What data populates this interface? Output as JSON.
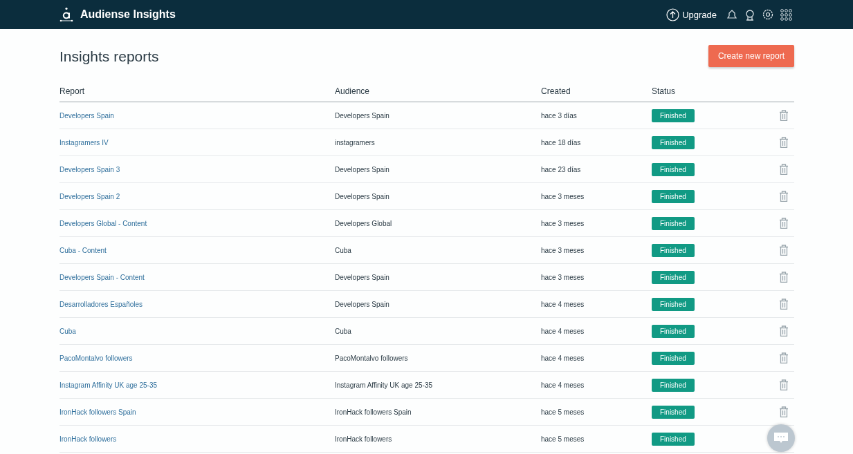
{
  "app": {
    "name": "Audiense Insights",
    "upgrade": "Upgrade"
  },
  "page": {
    "title": "Insights reports",
    "create_button": "Create new report"
  },
  "table": {
    "columns": [
      "Report",
      "Audience",
      "Created",
      "Status"
    ],
    "rows": [
      {
        "report": "Developers Spain",
        "audience": "Developers Spain",
        "created": "hace 3 días",
        "status": {
          "label": "Finished",
          "kind": "finished"
        }
      },
      {
        "report": "Instagramers IV",
        "audience": "instagramers",
        "created": "hace 18 días",
        "status": {
          "label": "Finished",
          "kind": "finished"
        }
      },
      {
        "report": "Developers Spain 3",
        "audience": "Developers Spain",
        "created": "hace 23 días",
        "status": {
          "label": "Finished",
          "kind": "finished"
        }
      },
      {
        "report": "Developers Spain 2",
        "audience": "Developers Spain",
        "created": "hace 3 meses",
        "status": {
          "label": "Finished",
          "kind": "finished"
        }
      },
      {
        "report": "Developers Global - Content",
        "audience": "Developers Global",
        "created": "hace 3 meses",
        "status": {
          "label": "Finished",
          "kind": "finished"
        }
      },
      {
        "report": "Cuba - Content",
        "audience": "Cuba",
        "created": "hace 3 meses",
        "status": {
          "label": "Finished",
          "kind": "finished"
        }
      },
      {
        "report": "Developers Spain - Content",
        "audience": "Developers Spain",
        "created": "hace 3 meses",
        "status": {
          "label": "Finished",
          "kind": "finished"
        }
      },
      {
        "report": "Desarrolladores Españoles",
        "audience": "Developers Spain",
        "created": "hace 4 meses",
        "status": {
          "label": "Finished",
          "kind": "finished"
        }
      },
      {
        "report": "Cuba",
        "audience": "Cuba",
        "created": "hace 4 meses",
        "status": {
          "label": "Finished",
          "kind": "finished"
        }
      },
      {
        "report": "PacoMontalvo followers",
        "audience": "PacoMontalvo followers",
        "created": "hace 4 meses",
        "status": {
          "label": "Finished",
          "kind": "finished"
        }
      },
      {
        "report": "Instagram Affinity UK age 25-35",
        "audience": "Instagram Affinity UK age 25-35",
        "created": "hace 4 meses",
        "status": {
          "label": "Finished",
          "kind": "finished"
        }
      },
      {
        "report": "IronHack followers Spain",
        "audience": "IronHack followers Spain",
        "created": "hace 5 meses",
        "status": {
          "label": "Finished",
          "kind": "finished"
        }
      },
      {
        "report": "IronHack followers",
        "audience": "IronHack followers",
        "created": "hace 5 meses",
        "status": {
          "label": "Finished",
          "kind": "finished"
        }
      }
    ]
  }
}
